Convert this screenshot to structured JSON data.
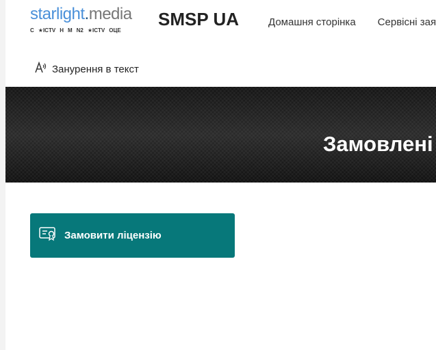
{
  "logo": {
    "part1": "starlight",
    "part2": ".",
    "part3": "media",
    "channels": [
      "C",
      "★ICTV",
      "H",
      "M",
      "N2",
      "★ICTV",
      "OЦЕ"
    ]
  },
  "header": {
    "site_title": "SMSP UA"
  },
  "nav": {
    "items": [
      {
        "label": "Домашня сторінка"
      },
      {
        "label": "Сервісні зая"
      }
    ]
  },
  "immersive": {
    "label": "Занурення в текст",
    "icon": "immersive-reader-icon"
  },
  "hero": {
    "title": "Замовлені"
  },
  "main": {
    "order_button": {
      "label": "Замовити ліцензію",
      "icon": "certificate-icon"
    }
  },
  "colors": {
    "accent": "#07787a",
    "hero_bg": "#1e1e1e",
    "logo_blue": "#4a90d9"
  }
}
